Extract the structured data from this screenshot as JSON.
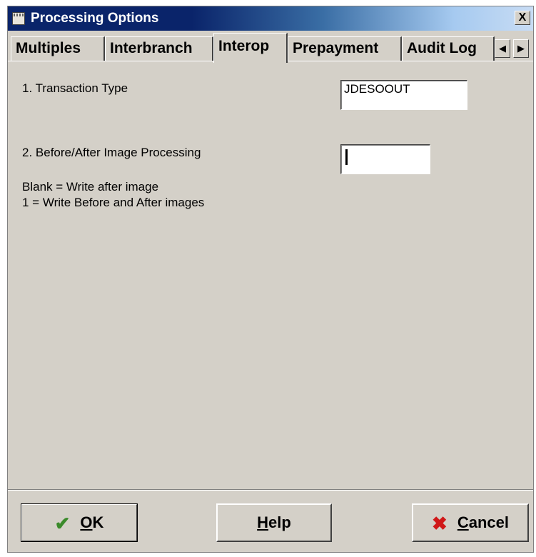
{
  "window": {
    "title": "Processing Options",
    "close_label": "X"
  },
  "tabs": [
    {
      "label": "Multiples",
      "active": false
    },
    {
      "label": "Interbranch",
      "active": false
    },
    {
      "label": "Interop",
      "active": true
    },
    {
      "label": "Prepayment",
      "active": false
    },
    {
      "label": "Audit Log",
      "active": false
    }
  ],
  "tab_scroll": {
    "left": "◀",
    "right": "▶"
  },
  "options": {
    "transaction_type": {
      "label": "1. Transaction Type",
      "value": "JDESOOUT"
    },
    "before_after": {
      "label": "2. Before/After Image Processing",
      "value": ""
    },
    "help_line_1": "Blank = Write after image",
    "help_line_2": "1 = Write Before and After images"
  },
  "buttons": {
    "ok": {
      "label": "OK",
      "accel": "O",
      "rest": "K",
      "icon": "check-icon"
    },
    "help": {
      "label": "Help",
      "accel": "H",
      "rest": "elp"
    },
    "cancel": {
      "label": "Cancel",
      "accel": "C",
      "rest": "ancel",
      "icon": "cancel-x-icon"
    }
  },
  "colors": {
    "window_bg": "#d4d0c8",
    "titlebar_start": "#0a246a",
    "titlebar_end": "#c8dcf4",
    "check_green": "#3a8a2a",
    "cancel_red": "#d01818"
  }
}
